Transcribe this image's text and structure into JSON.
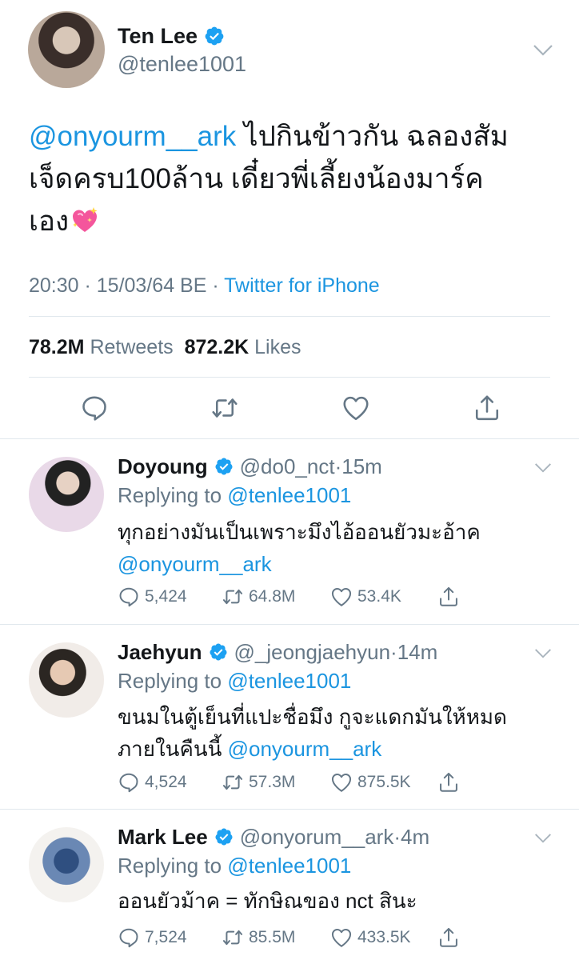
{
  "main_tweet": {
    "name": "Ten Lee",
    "handle": "@tenlee1001",
    "mention": "@onyourm__ark",
    "text_line1": " ไปกินข้าวกัน ฉลองสัม",
    "text_line2": "เจ็ดครบ100ล้าน เดี๋ยวพี่เลี้ยงน้องมาร์ค",
    "text_line3": "เอง",
    "emoji": "sparkling-heart-icon",
    "time": "20:30 · 15/03/64 BE · ",
    "source": "Twitter for iPhone",
    "retweets_count": "78.2M",
    "retweets_label": "Retweets",
    "likes_count": "872.2K",
    "likes_label": "Likes"
  },
  "replies": [
    {
      "name": "Doyoung",
      "handle": "@do0_nct",
      "time": "·15m",
      "replying_prefix": "Replying to ",
      "replying_to": "@tenlee1001",
      "text": "ทุกอย่างมันเป็นเพราะมึงไอ้ออนยัวมะอ้าค",
      "mention": "@onyourm__ark",
      "reply_count": "5,424",
      "retweet_count": "64.8M",
      "like_count": "53.4K"
    },
    {
      "name": "Jaehyun",
      "handle": "@_jeongjaehyun",
      "time": "·14m",
      "replying_prefix": "Replying to ",
      "replying_to": "@tenlee1001",
      "text_line1": "ขนมในตู้เย็นที่แปะชื่อมึง กูจะแดกมันให้หมด",
      "text_line2": "ภายในคืนนี้ ",
      "mention": "@onyourm__ark",
      "reply_count": "4,524",
      "retweet_count": "57.3M",
      "like_count": "875.5K"
    },
    {
      "name": "Mark Lee",
      "handle": "@onyorum__ark",
      "time": "·4m",
      "replying_prefix": "Replying to ",
      "replying_to": "@tenlee1001",
      "text": "ออนยัวม้าค = ทักษิณของ nct สินะ",
      "reply_count": "7,524",
      "retweet_count": "85.5M",
      "like_count": "433.5K"
    }
  ],
  "colors": {
    "link": "#1b95e0",
    "verified": "#1da1f2",
    "secondary": "#657786",
    "divider": "#e1e8ed"
  }
}
